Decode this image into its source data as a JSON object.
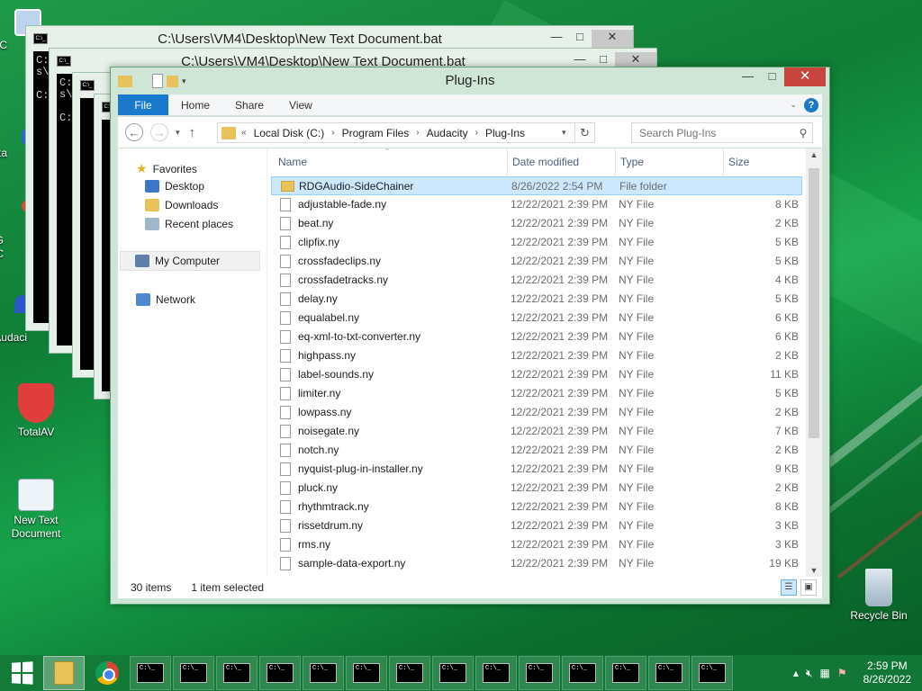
{
  "desktop": {
    "icons": [
      {
        "label": "My C"
      },
      {
        "label": "Data"
      },
      {
        "label": "G"
      },
      {
        "label": "C"
      },
      {
        "label": "Audaci"
      },
      {
        "label": "TotalAV"
      },
      {
        "label": "New Text Document"
      },
      {
        "label": "Recycle Bin"
      }
    ]
  },
  "console_windows": [
    {
      "title": "C:\\Users\\VM4\\Desktop\\New Text Document.bat",
      "body": "C:\ns\\\n\nC:"
    },
    {
      "title": "C:\\Users\\VM4\\Desktop\\New Text Document.bat",
      "body": "C:\ns\\\n\nC:"
    }
  ],
  "explorer": {
    "title": "Plug-Ins",
    "ribbon_tabs": [
      "File",
      "Home",
      "Share",
      "View"
    ],
    "address": {
      "prefix": "«",
      "crumbs": [
        "Local Disk (C:)",
        "Program Files",
        "Audacity",
        "Plug-Ins"
      ]
    },
    "search": {
      "placeholder": "Search Plug-Ins"
    },
    "nav_pane": {
      "favorites_label": "Favorites",
      "favorites": [
        "Desktop",
        "Downloads",
        "Recent places"
      ],
      "computer": "My Computer",
      "network": "Network"
    },
    "columns": {
      "name": "Name",
      "date": "Date modified",
      "type": "Type",
      "size": "Size"
    },
    "files": [
      {
        "name": "RDGAudio-SideChainer",
        "date": "8/26/2022 2:54 PM",
        "type": "File folder",
        "size": "",
        "kind": "folder",
        "selected": true
      },
      {
        "name": "adjustable-fade.ny",
        "date": "12/22/2021 2:39 PM",
        "type": "NY File",
        "size": "8 KB"
      },
      {
        "name": "beat.ny",
        "date": "12/22/2021 2:39 PM",
        "type": "NY File",
        "size": "2 KB"
      },
      {
        "name": "clipfix.ny",
        "date": "12/22/2021 2:39 PM",
        "type": "NY File",
        "size": "5 KB"
      },
      {
        "name": "crossfadeclips.ny",
        "date": "12/22/2021 2:39 PM",
        "type": "NY File",
        "size": "5 KB"
      },
      {
        "name": "crossfadetracks.ny",
        "date": "12/22/2021 2:39 PM",
        "type": "NY File",
        "size": "4 KB"
      },
      {
        "name": "delay.ny",
        "date": "12/22/2021 2:39 PM",
        "type": "NY File",
        "size": "5 KB"
      },
      {
        "name": "equalabel.ny",
        "date": "12/22/2021 2:39 PM",
        "type": "NY File",
        "size": "6 KB"
      },
      {
        "name": "eq-xml-to-txt-converter.ny",
        "date": "12/22/2021 2:39 PM",
        "type": "NY File",
        "size": "6 KB"
      },
      {
        "name": "highpass.ny",
        "date": "12/22/2021 2:39 PM",
        "type": "NY File",
        "size": "2 KB"
      },
      {
        "name": "label-sounds.ny",
        "date": "12/22/2021 2:39 PM",
        "type": "NY File",
        "size": "11 KB"
      },
      {
        "name": "limiter.ny",
        "date": "12/22/2021 2:39 PM",
        "type": "NY File",
        "size": "5 KB"
      },
      {
        "name": "lowpass.ny",
        "date": "12/22/2021 2:39 PM",
        "type": "NY File",
        "size": "2 KB"
      },
      {
        "name": "noisegate.ny",
        "date": "12/22/2021 2:39 PM",
        "type": "NY File",
        "size": "7 KB"
      },
      {
        "name": "notch.ny",
        "date": "12/22/2021 2:39 PM",
        "type": "NY File",
        "size": "2 KB"
      },
      {
        "name": "nyquist-plug-in-installer.ny",
        "date": "12/22/2021 2:39 PM",
        "type": "NY File",
        "size": "9 KB"
      },
      {
        "name": "pluck.ny",
        "date": "12/22/2021 2:39 PM",
        "type": "NY File",
        "size": "2 KB"
      },
      {
        "name": "rhythmtrack.ny",
        "date": "12/22/2021 2:39 PM",
        "type": "NY File",
        "size": "8 KB"
      },
      {
        "name": "rissetdrum.ny",
        "date": "12/22/2021 2:39 PM",
        "type": "NY File",
        "size": "3 KB"
      },
      {
        "name": "rms.ny",
        "date": "12/22/2021 2:39 PM",
        "type": "NY File",
        "size": "3 KB"
      },
      {
        "name": "sample-data-export.ny",
        "date": "12/22/2021 2:39 PM",
        "type": "NY File",
        "size": "19 KB"
      }
    ],
    "status": {
      "count": "30 items",
      "selection": "1 item selected"
    }
  },
  "taskbar": {
    "clock_time": "2:59 PM",
    "clock_date": "8/26/2022",
    "console_buttons": 14,
    "cmd_glyph": "C:\\_"
  },
  "colors": {
    "accent": "#1979ca",
    "selection": "#cce8ff",
    "close": "#c7453c",
    "desktop": "#0f7d36"
  }
}
